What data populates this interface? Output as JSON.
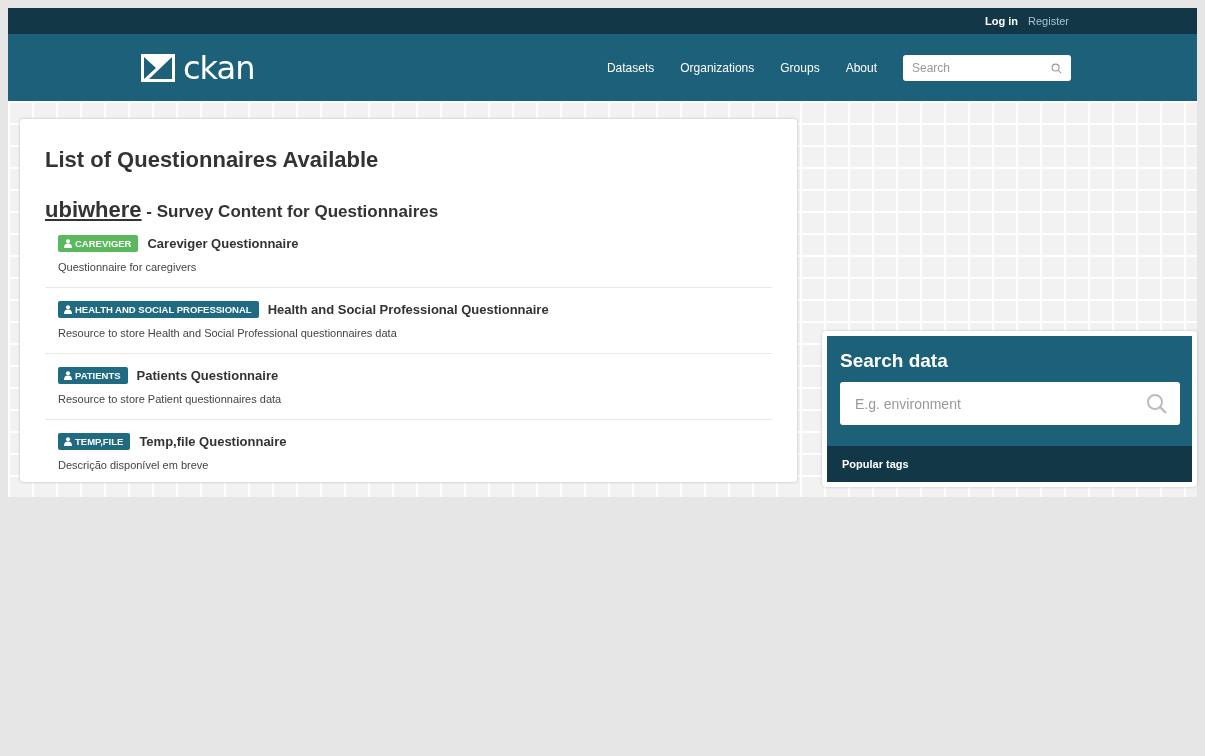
{
  "account_links": [
    {
      "label": "Log in",
      "kind": "primary"
    },
    {
      "label": "Register",
      "kind": "secondary"
    }
  ],
  "logo": {
    "text": "ckan"
  },
  "nav": [
    "Datasets",
    "Organizations",
    "Groups",
    "About"
  ],
  "header_search": {
    "placeholder": "Search"
  },
  "main": {
    "title": "List of Questionnaires Available",
    "organization": "ubiwhere",
    "subtitle": "- Survey Content for Questionnaires",
    "resources": [
      {
        "tag": "CAREVIGER",
        "color": "#5cb85c",
        "title": "Careviger Questionnaire",
        "description": "Questionnaire for caregivers"
      },
      {
        "tag": "HEALTH AND SOCIAL PROFESSIONAL",
        "color": "#206b82",
        "title": "Health and Social Professional Questionnaire",
        "description": "Resource to store Health and Social Professional questionnaires data"
      },
      {
        "tag": "PATIENTS",
        "color": "#206b82",
        "title": "Patients Questionnaire",
        "description": "Resource to store Patient questionnaires data"
      },
      {
        "tag": "TEMP,FILE",
        "color": "#206b82",
        "title": "Temp,file Questionnaire",
        "description": "Descrição disponível em breve"
      }
    ]
  },
  "search_module": {
    "title": "Search data",
    "placeholder": "E.g. environment",
    "footer": "Popular tags"
  }
}
